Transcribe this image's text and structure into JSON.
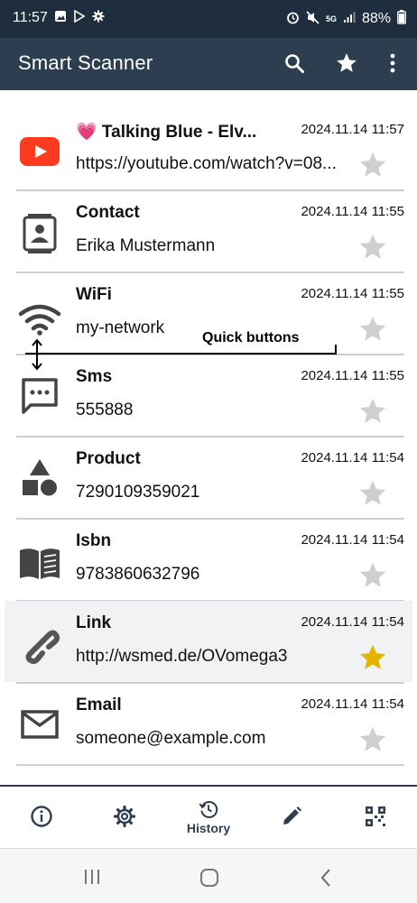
{
  "status": {
    "time": "11:57",
    "battery": "88%"
  },
  "app": {
    "title": "Smart Scanner"
  },
  "items": [
    {
      "icon": "youtube-icon",
      "title": "💗 Talking Blue -  Elv...",
      "date": "2024.11.14 11:57",
      "value": "https://youtube.com/watch?v=08...",
      "starred": false
    },
    {
      "icon": "contact-icon",
      "title": "Contact",
      "date": "2024.11.14 11:55",
      "value": "Erika Mustermann",
      "starred": false
    },
    {
      "icon": "wifi-icon",
      "title": "WiFi",
      "date": "2024.11.14 11:55",
      "value": "my-network",
      "starred": false
    },
    {
      "icon": "sms-icon",
      "title": "Sms",
      "date": "2024.11.14 11:55",
      "value": "555888",
      "starred": false
    },
    {
      "icon": "product-icon",
      "title": "Product",
      "date": "2024.11.14 11:54",
      "value": "7290109359021",
      "starred": false
    },
    {
      "icon": "book-icon",
      "title": "Isbn",
      "date": "2024.11.14 11:54",
      "value": "9783860632796",
      "starred": false
    },
    {
      "icon": "link-icon",
      "title": "Link",
      "date": "2024.11.14 11:54",
      "value": "http://wsmed.de/OVomega3",
      "starred": true
    },
    {
      "icon": "email-icon",
      "title": "Email",
      "date": "2024.11.14 11:54",
      "value": "someone@example.com",
      "starred": false
    }
  ],
  "annotation": {
    "text": "Quick buttons"
  },
  "bottom_nav": {
    "active_label": "History"
  },
  "colors": {
    "appbar": "#2c3e50",
    "star_off": "#cfcfcf",
    "star_on": "#e6b400",
    "youtube": "#ff3b1f"
  }
}
